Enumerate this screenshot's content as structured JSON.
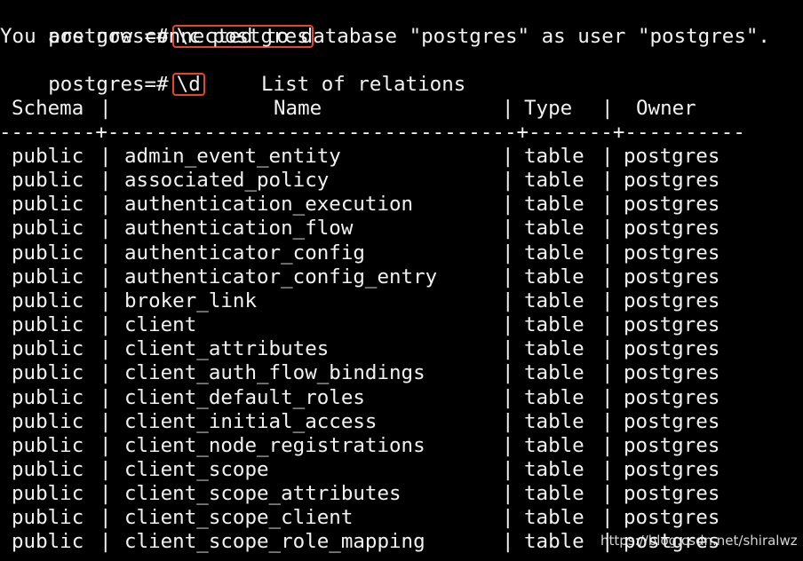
{
  "terminal": {
    "prompt": "postgres=#",
    "commands": [
      "\\c postgres",
      "\\d"
    ],
    "connect_message": "You are now connected to database \"postgres\" as user \"postgres\".",
    "table_title": "List of relations",
    "columns": [
      "Schema",
      "Name",
      "Type",
      "Owner"
    ],
    "separator": "--------+----------------------------------+-------+----------",
    "rows": [
      [
        "public",
        "admin_event_entity",
        "table",
        "postgres"
      ],
      [
        "public",
        "associated_policy",
        "table",
        "postgres"
      ],
      [
        "public",
        "authentication_execution",
        "table",
        "postgres"
      ],
      [
        "public",
        "authentication_flow",
        "table",
        "postgres"
      ],
      [
        "public",
        "authenticator_config",
        "table",
        "postgres"
      ],
      [
        "public",
        "authenticator_config_entry",
        "table",
        "postgres"
      ],
      [
        "public",
        "broker_link",
        "table",
        "postgres"
      ],
      [
        "public",
        "client",
        "table",
        "postgres"
      ],
      [
        "public",
        "client_attributes",
        "table",
        "postgres"
      ],
      [
        "public",
        "client_auth_flow_bindings",
        "table",
        "postgres"
      ],
      [
        "public",
        "client_default_roles",
        "table",
        "postgres"
      ],
      [
        "public",
        "client_initial_access",
        "table",
        "postgres"
      ],
      [
        "public",
        "client_node_registrations",
        "table",
        "postgres"
      ],
      [
        "public",
        "client_scope",
        "table",
        "postgres"
      ],
      [
        "public",
        "client_scope_attributes",
        "table",
        "postgres"
      ],
      [
        "public",
        "client_scope_client",
        "table",
        "postgres"
      ],
      [
        "public",
        "client_scope_role_mapping",
        "table",
        "postgres"
      ]
    ],
    "highlight_color": "#e2472b"
  },
  "watermark": "https://blog.csdn.net/shiralwz"
}
